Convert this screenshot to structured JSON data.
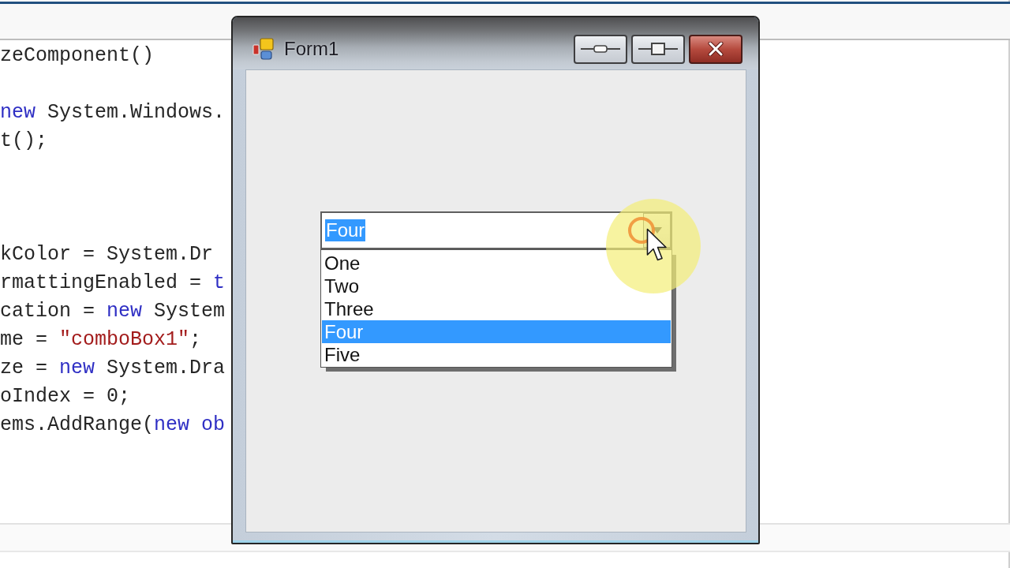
{
  "editor": {
    "lines": [
      {
        "kind": "code",
        "segments": [
          {
            "kind": "plain",
            "text": "zeComponent()"
          }
        ]
      },
      {
        "kind": "blank"
      },
      {
        "kind": "code",
        "segments": [
          {
            "kind": "keyword",
            "text": "new"
          },
          {
            "kind": "plain",
            "text": " System.Windows."
          }
        ]
      },
      {
        "kind": "code",
        "segments": [
          {
            "kind": "plain",
            "text": "t();"
          }
        ]
      },
      {
        "kind": "blank"
      },
      {
        "kind": "blank"
      },
      {
        "kind": "blank"
      },
      {
        "kind": "code",
        "segments": [
          {
            "kind": "plain",
            "text": "kColor = System.Dr"
          }
        ]
      },
      {
        "kind": "code",
        "segments": [
          {
            "kind": "plain",
            "text": "rmattingEnabled = "
          },
          {
            "kind": "keyword",
            "text": "t"
          }
        ]
      },
      {
        "kind": "code",
        "segments": [
          {
            "kind": "plain",
            "text": "cation = "
          },
          {
            "kind": "keyword",
            "text": "new"
          },
          {
            "kind": "plain",
            "text": " System"
          }
        ]
      },
      {
        "kind": "code",
        "segments": [
          {
            "kind": "plain",
            "text": "me = "
          },
          {
            "kind": "string",
            "text": "\"comboBox1\""
          },
          {
            "kind": "plain",
            "text": ";"
          }
        ]
      },
      {
        "kind": "code",
        "segments": [
          {
            "kind": "plain",
            "text": "ze = "
          },
          {
            "kind": "keyword",
            "text": "new"
          },
          {
            "kind": "plain",
            "text": " System.Dra"
          }
        ]
      },
      {
        "kind": "code",
        "segments": [
          {
            "kind": "plain",
            "text": "oIndex = 0;"
          }
        ]
      },
      {
        "kind": "code",
        "segments": [
          {
            "kind": "plain",
            "text": "ems.AddRange("
          },
          {
            "kind": "keyword",
            "text": "new ob"
          }
        ]
      }
    ]
  },
  "window": {
    "title": "Form1"
  },
  "combo_box": {
    "value": "Four",
    "value_selected": true,
    "expanded": true,
    "items": [
      {
        "label": "One",
        "selected": false
      },
      {
        "label": "Two",
        "selected": false
      },
      {
        "label": "Three",
        "selected": false
      },
      {
        "label": "Four",
        "selected": true
      },
      {
        "label": "Five",
        "selected": false
      }
    ]
  }
}
